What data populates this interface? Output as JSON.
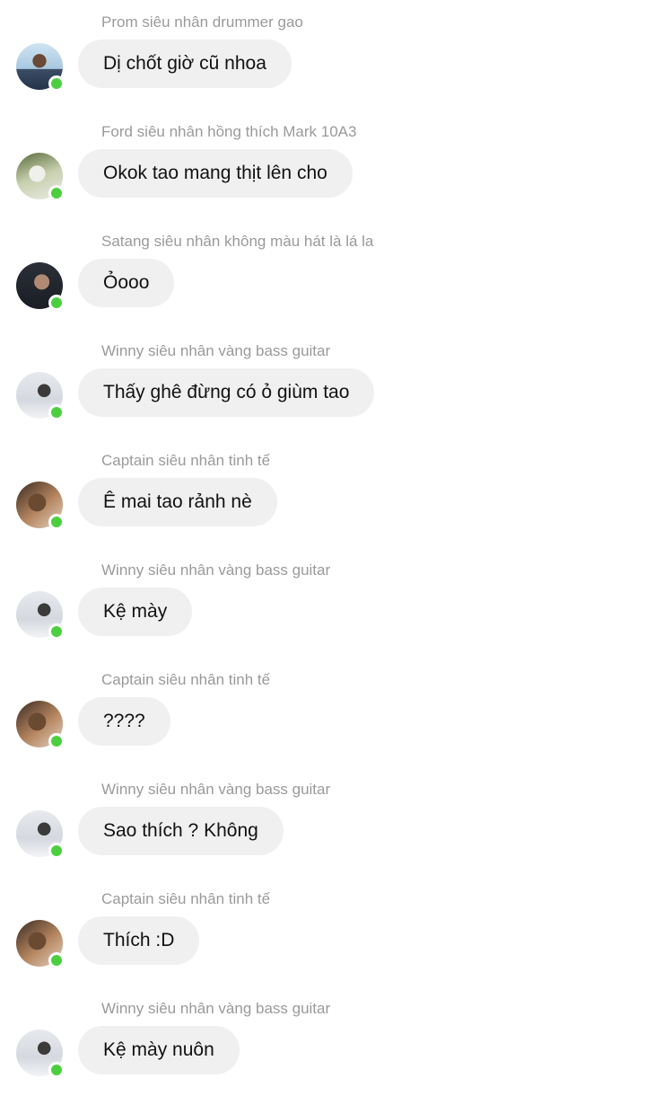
{
  "messages": [
    {
      "sender": "Prom siêu nhân drummer gao",
      "text": "Dị chốt giờ cũ nhoa",
      "avatar": "avatar-photo",
      "online": true
    },
    {
      "sender": "Ford siêu nhân hồng thích Mark 10A3",
      "text": "Okok tao mang thịt lên cho",
      "avatar": "avatar-photo",
      "online": true
    },
    {
      "sender": "Satang siêu nhân không màu hát là lá la",
      "text": "Ỏooo",
      "avatar": "avatar-photo",
      "online": true
    },
    {
      "sender": "Winny siêu nhân vàng bass guitar",
      "text": "Thấy ghê đừng có ỏ giùm tao",
      "avatar": "avatar-photo",
      "online": true
    },
    {
      "sender": "Captain siêu nhân tinh tế",
      "text": "Ê mai tao rảnh nè",
      "avatar": "avatar-photo",
      "online": true
    },
    {
      "sender": "Winny siêu nhân vàng bass guitar",
      "text": "Kệ mày",
      "avatar": "avatar-photo",
      "online": true
    },
    {
      "sender": "Captain siêu nhân tinh tế",
      "text": "????",
      "avatar": "avatar-photo",
      "online": true
    },
    {
      "sender": "Winny siêu nhân vàng bass guitar",
      "text": "Sao thích ? Không",
      "avatar": "avatar-photo",
      "online": true
    },
    {
      "sender": "Captain siêu nhân tinh tế",
      "text": "Thích :D",
      "avatar": "avatar-photo",
      "online": true
    },
    {
      "sender": "Winny siêu nhân vàng bass guitar",
      "text": "Kệ mày nuôn",
      "avatar": "avatar-photo",
      "online": true
    }
  ],
  "colors": {
    "bubble": "#f0f0f0",
    "sender": "#9a9a9a",
    "online": "#4ccf3f"
  }
}
